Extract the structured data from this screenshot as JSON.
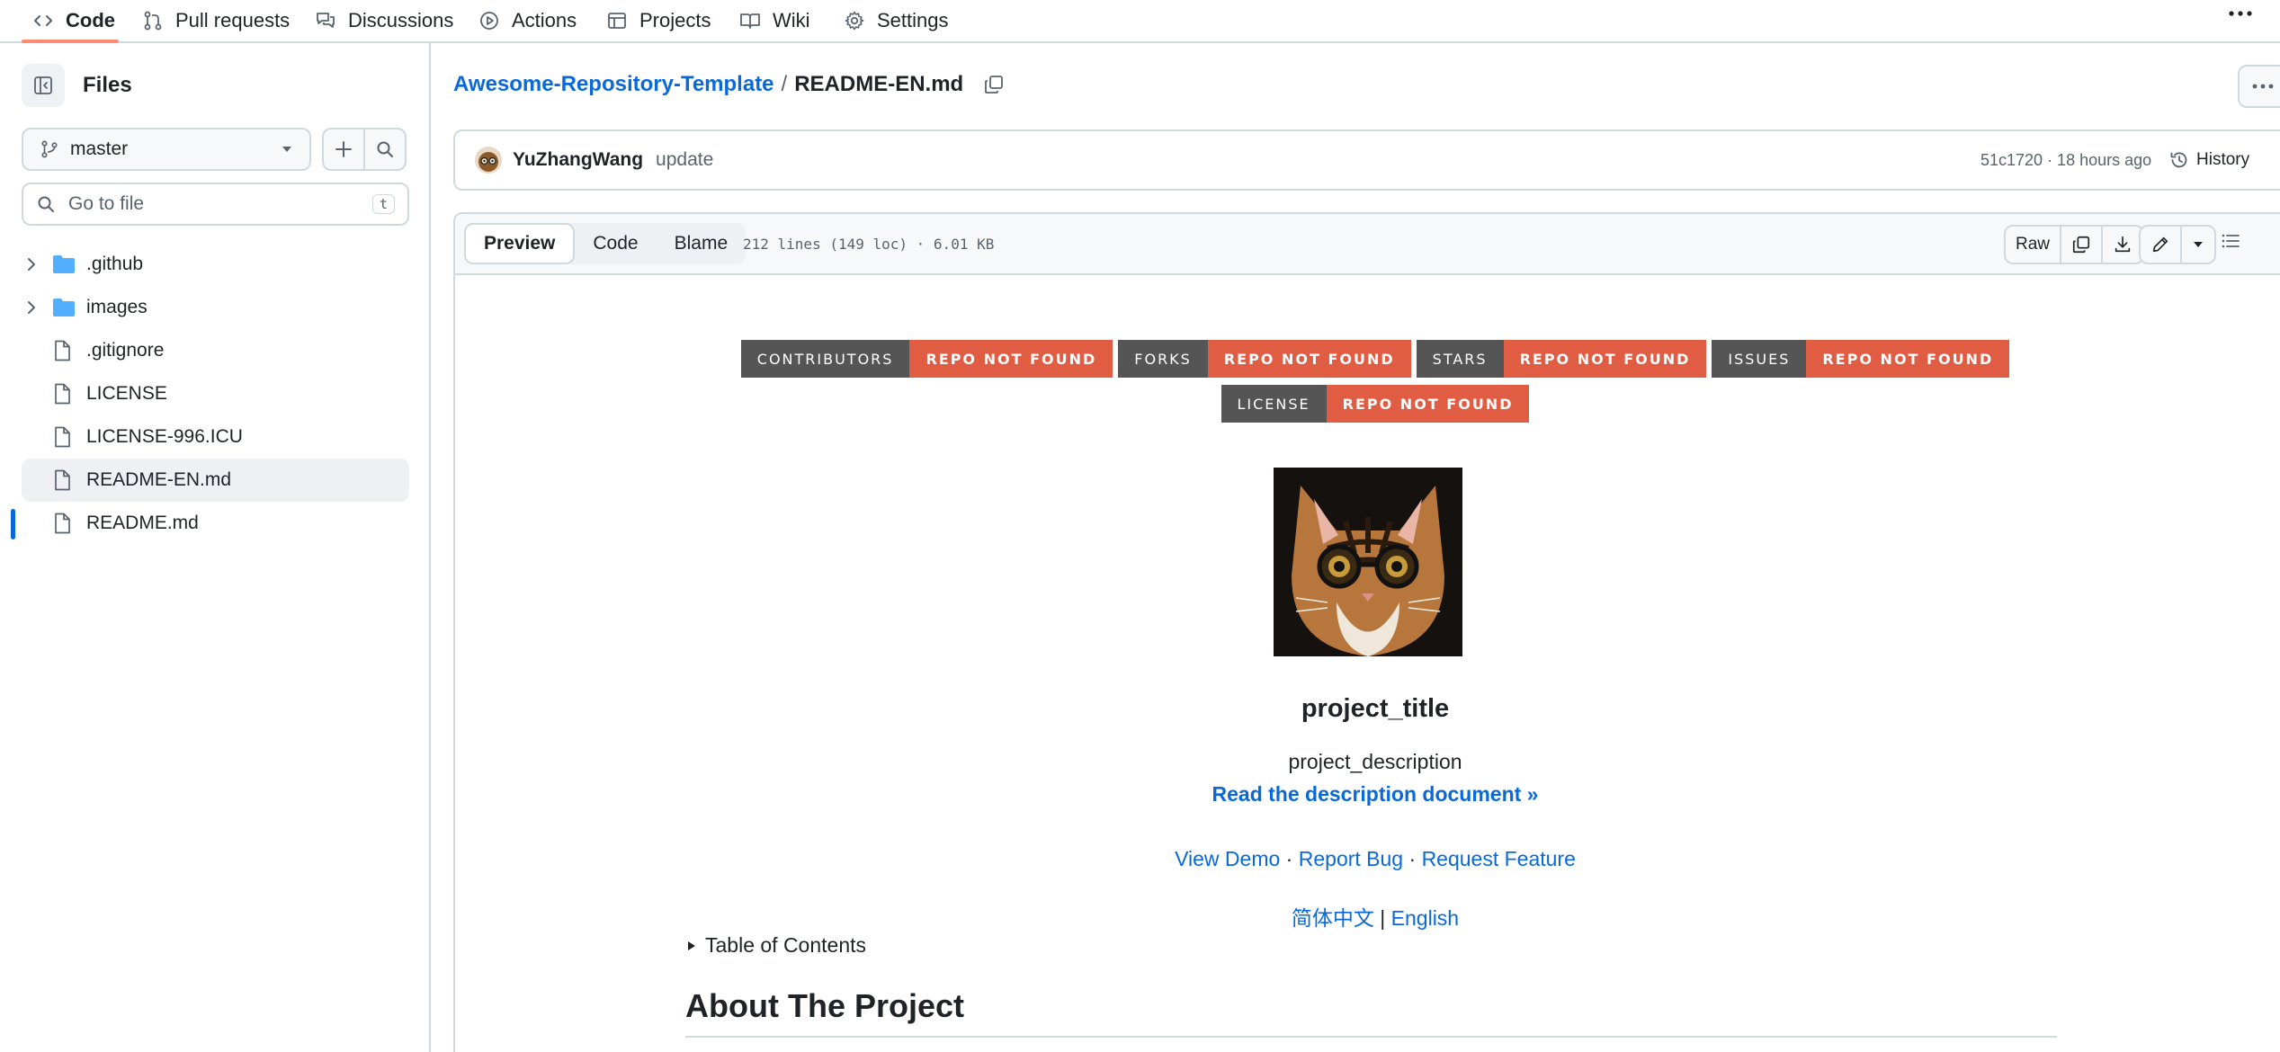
{
  "nav": {
    "tabs": [
      {
        "label": "Code",
        "icon": "code-icon",
        "active": true
      },
      {
        "label": "Pull requests",
        "icon": "pull-request-icon"
      },
      {
        "label": "Discussions",
        "icon": "discussions-icon"
      },
      {
        "label": "Actions",
        "icon": "play-icon"
      },
      {
        "label": "Projects",
        "icon": "table-icon"
      },
      {
        "label": "Wiki",
        "icon": "book-icon"
      },
      {
        "label": "Settings",
        "icon": "gear-icon"
      }
    ]
  },
  "sidebar": {
    "title": "Files",
    "branch": "master",
    "search_placeholder": "Go to file",
    "search_shortcut": "t",
    "items": [
      {
        "label": ".github",
        "type": "folder"
      },
      {
        "label": "images",
        "type": "folder"
      },
      {
        "label": ".gitignore",
        "type": "file"
      },
      {
        "label": "LICENSE",
        "type": "file"
      },
      {
        "label": "LICENSE-996.ICU",
        "type": "file"
      },
      {
        "label": "README-EN.md",
        "type": "file",
        "selected": true
      },
      {
        "label": "README.md",
        "type": "file"
      }
    ]
  },
  "breadcrumb": {
    "repo": "Awesome-Repository-Template",
    "separator": "/",
    "file": "README-EN.md"
  },
  "commit": {
    "author": "YuZhangWang",
    "message": "update",
    "meta": "51c1720 · 18 hours ago",
    "history_label": "History"
  },
  "file_header": {
    "tabs": [
      "Preview",
      "Code",
      "Blame"
    ],
    "active_tab": "Preview",
    "info": "212 lines (149 loc) · 6.01 KB",
    "raw_label": "Raw"
  },
  "readme": {
    "badges": [
      {
        "label": "CONTRIBUTORS",
        "message": "REPO NOT FOUND"
      },
      {
        "label": "FORKS",
        "message": "REPO NOT FOUND"
      },
      {
        "label": "STARS",
        "message": "REPO NOT FOUND"
      },
      {
        "label": "ISSUES",
        "message": "REPO NOT FOUND"
      },
      {
        "label": "LICENSE",
        "message": "REPO NOT FOUND"
      }
    ],
    "title": "project_title",
    "description": "project_description",
    "read_doc": "Read the description document »",
    "links": {
      "demo": "View Demo",
      "sep": " · ",
      "bug": "Report Bug",
      "feature": "Request Feature"
    },
    "langs": {
      "zh": "简体中文",
      "sep": " | ",
      "en": "English"
    },
    "toc": "Table of Contents",
    "about_heading": "About The Project"
  },
  "colors": {
    "accent": "#0969da",
    "badge_label": "#555555",
    "badge_message": "#e05d44",
    "nav_underline": "#fd8c73",
    "folder": "#54aeff"
  }
}
